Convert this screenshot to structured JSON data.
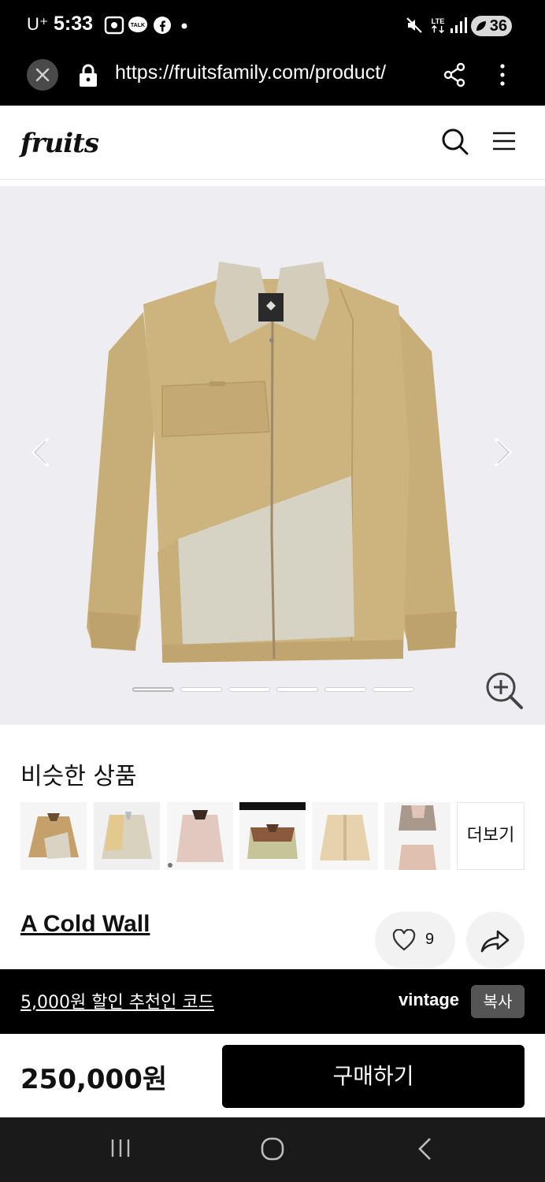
{
  "status_bar": {
    "carrier": "U⁺",
    "time": "5:33",
    "network": "LTE",
    "battery": "36"
  },
  "browser": {
    "url": "https://fruitsfamily.com/product/"
  },
  "header": {
    "logo": "fruits"
  },
  "gallery": {
    "image_count": 6,
    "active_index": 0
  },
  "similar": {
    "title": "비슷한 상품",
    "more_label": "더보기",
    "selected_index": 3
  },
  "product": {
    "brand": "A Cold Wall",
    "likes": "9"
  },
  "promo": {
    "text": "5,000원 할인 추천인 코드",
    "code": "vintage",
    "copy_label": "복사"
  },
  "purchase": {
    "price": "250,000원",
    "buy_label": "구매하기"
  },
  "colors": {
    "accent": "#000000",
    "jacket_khaki": "#cdb37d",
    "jacket_panel": "#d6d2c4"
  }
}
